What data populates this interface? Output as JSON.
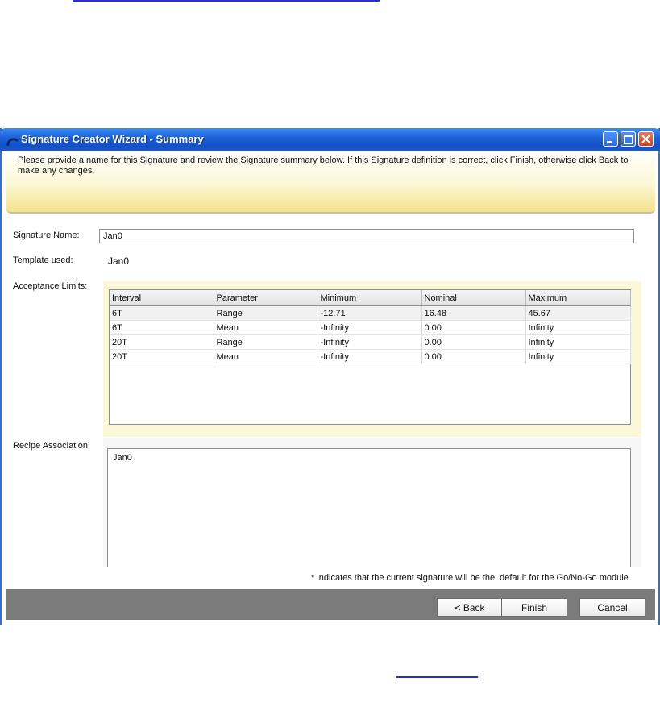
{
  "window": {
    "title": "Signature Creator Wizard - Summary",
    "controls": [
      "minimize-icon",
      "maximize-icon",
      "close-icon"
    ]
  },
  "header": {
    "instructions": "Please provide a name for this Signature and review the Signature summary below. If this Signature definition is correct, click Finish, otherwise click Back to make any changes."
  },
  "form": {
    "signature_name_label": "Signature Name:",
    "signature_name_value": "Jan0",
    "template_label": "Template used:",
    "template_value": "Jan0",
    "acceptance_label": "Acceptance Limits:",
    "recipe_label": "Recipe Association:"
  },
  "limits_table": {
    "columns": [
      "Interval",
      "Parameter",
      "Minimum",
      "Nominal",
      "Maximum"
    ],
    "rows": [
      [
        "6T",
        "Range",
        "-12.71",
        "16.48",
        "45.67"
      ],
      [
        "6T",
        "Mean",
        "-Infinity",
        "0.00",
        "Infinity"
      ],
      [
        "20T",
        "Range",
        "-Infinity",
        "0.00",
        "Infinity"
      ],
      [
        "20T",
        "Mean",
        "-Infinity",
        "0.00",
        "Infinity"
      ]
    ]
  },
  "recipes": [
    "Jan0"
  ],
  "footnote": "* indicates that the current signature will be the  default for the Go/No-Go module.",
  "buttons": {
    "back": "< Back",
    "finish": "Finish",
    "cancel": "Cancel"
  },
  "colors": {
    "titlebar": "#1b5fd6",
    "header_band": "#f3e18a",
    "limits_panel": "#fbf8d8",
    "footer_bar": "#7b7b7b"
  }
}
